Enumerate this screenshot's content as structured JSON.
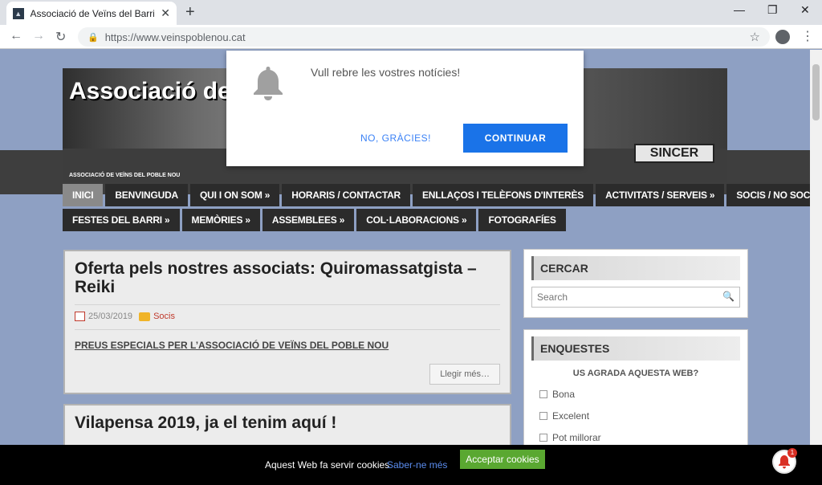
{
  "browser": {
    "tab_title": "Associació de Veïns del Barri del",
    "url": "https://www.veinspoblenou.cat",
    "new_tab": "+",
    "tab_close": "✕",
    "minimize": "—",
    "restore": "❐",
    "close": "✕"
  },
  "header": {
    "brand": "Associació de Veïns d",
    "subtitle": "ASSOCIACIÓ DE VEÏNS DEL POBLE NOU",
    "sign": "SINCER"
  },
  "menu": {
    "row1": [
      "INICI",
      "BENVINGUDA",
      "QUI I ON SOM »",
      "HORARIS / CONTACTAR",
      "ENLLAÇOS I TELÈFONS D'INTERÈS",
      "ACTIVITATS / SERVEIS »",
      "SOCIS / NO SOCIS / VEÏNS… »"
    ],
    "row2": [
      "FESTES DEL BARRI »",
      "MEMÒRIES »",
      "ASSEMBLEES »",
      "COL·LABORACIONS »",
      "FOTOGRAFÍES"
    ]
  },
  "posts": [
    {
      "title": "Oferta pels nostres associats: Quiromassatgista – Reiki",
      "date": "25/03/2019",
      "category": "Socis",
      "excerpt": "PREUS ESPECIALS PER L’ASSOCIACIÓ DE VEÏNS DEL POBLE NOU",
      "more": "Llegir més…"
    },
    {
      "title": "Vilapensa 2019, ja el tenim aquí !"
    }
  ],
  "sidebar": {
    "search_title": "CERCAR",
    "search_placeholder": "Search",
    "poll_title": "ENQUESTES",
    "poll_question": "US AGRADA AQUESTA WEB?",
    "poll_options": [
      "Bona",
      "Excelent",
      "Pot millorar"
    ]
  },
  "prompt": {
    "message": "Vull rebre les vostres notícies!",
    "decline": "NO, GRÀCIES!",
    "accept": "CONTINUAR"
  },
  "cookie": {
    "text": "Aquest Web fa servir cookies",
    "link": "Saber-ne més",
    "button": "Acceptar cookies",
    "badge": "1"
  },
  "colors": {
    "page_bg": "#8ea0c3",
    "accept_blue": "#1a73e8",
    "cookie_green": "#5aa831"
  }
}
